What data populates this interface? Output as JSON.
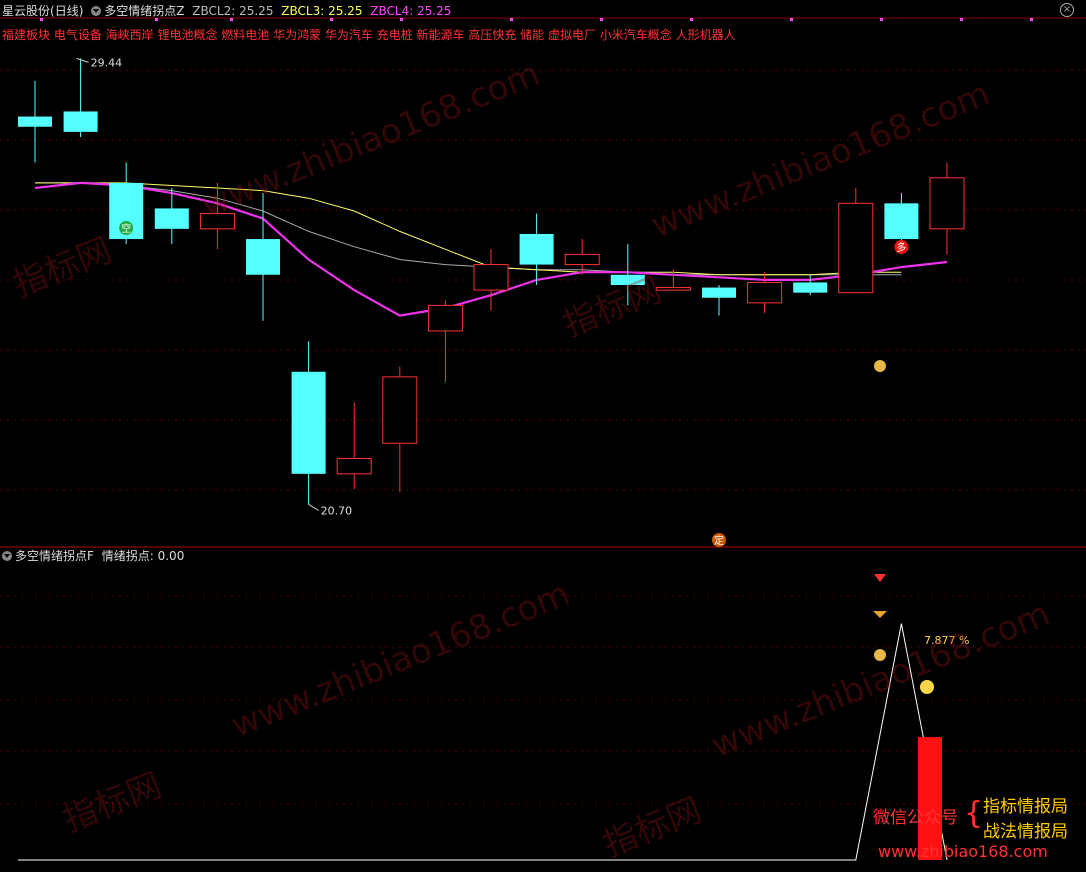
{
  "header": {
    "stock": "星云股份",
    "period": "(日线)",
    "indicator": "多空情绪拐点Z",
    "zb2": {
      "label": "ZBCL2:",
      "value": "25.25",
      "color": "#bbbbbb"
    },
    "zb3": {
      "label": "ZBCL3:",
      "value": "25.25",
      "color": "#ffff55"
    },
    "zb4": {
      "label": "ZBCL4:",
      "value": "25.25",
      "color": "#ff44ff"
    },
    "concepts": "福建板块 电气设备 海峡西岸 锂电池概念 燃料电池 华为鸿蒙 华为汽车 充电桩 新能源车 高压快充 储能 虚拟电厂 小米汽车概念 人形机器人"
  },
  "sub_header": {
    "indicator": "多空情绪拐点F",
    "label": "情绪拐点:",
    "value": "0.00"
  },
  "watermark": {
    "site": "www.zhibiao168.com",
    "cn": "指标网"
  },
  "promo": {
    "left": "微信公众号",
    "right1": "指标情报局",
    "right2": "战法情报局",
    "url": "www.zhibiao168.com"
  },
  "colors": {
    "up": "#ff3333",
    "down": "#55ffff",
    "ma_fast": "#ee33ee",
    "ma_mid": "#ffff66",
    "ma_slow": "#aaaaaa"
  },
  "chart_data": [
    {
      "type": "candlestick",
      "price_high_label": "29.44",
      "price_low_label": "20.70",
      "candles": [
        {
          "o": 28.3,
          "h": 29.0,
          "l": 27.4,
          "c": 28.1
        },
        {
          "o": 28.4,
          "h": 29.44,
          "l": 27.9,
          "c": 28.0
        },
        {
          "o": 27.0,
          "h": 27.4,
          "l": 25.8,
          "c": 25.9
        },
        {
          "o": 26.5,
          "h": 26.9,
          "l": 25.8,
          "c": 26.1
        },
        {
          "o": 26.1,
          "h": 27.0,
          "l": 25.7,
          "c": 26.4
        },
        {
          "o": 25.9,
          "h": 26.8,
          "l": 24.3,
          "c": 25.2
        },
        {
          "o": 23.3,
          "h": 23.9,
          "l": 20.7,
          "c": 21.3
        },
        {
          "o": 21.3,
          "h": 22.7,
          "l": 21.0,
          "c": 21.6
        },
        {
          "o": 21.9,
          "h": 23.4,
          "l": 20.95,
          "c": 23.2
        },
        {
          "o": 24.1,
          "h": 24.7,
          "l": 23.1,
          "c": 24.6
        },
        {
          "o": 24.9,
          "h": 25.7,
          "l": 24.5,
          "c": 25.4
        },
        {
          "o": 26.0,
          "h": 26.4,
          "l": 25.0,
          "c": 25.4
        },
        {
          "o": 25.4,
          "h": 25.9,
          "l": 25.2,
          "c": 25.6
        },
        {
          "o": 25.2,
          "h": 25.8,
          "l": 24.6,
          "c": 25.0
        },
        {
          "o": 24.9,
          "h": 25.3,
          "l": 24.9,
          "c": 24.95
        },
        {
          "o": 24.95,
          "h": 25.0,
          "l": 24.4,
          "c": 24.75
        },
        {
          "o": 24.65,
          "h": 25.25,
          "l": 24.45,
          "c": 25.05
        },
        {
          "o": 25.05,
          "h": 25.2,
          "l": 24.8,
          "c": 24.85
        },
        {
          "o": 24.85,
          "h": 26.9,
          "l": 24.85,
          "c": 26.6
        },
        {
          "o": 26.6,
          "h": 26.8,
          "l": 25.6,
          "c": 25.9
        },
        {
          "o": 26.1,
          "h": 27.4,
          "l": 25.6,
          "c": 27.1
        }
      ],
      "ma_fast": [
        26.9,
        27.0,
        26.95,
        26.8,
        26.6,
        26.3,
        25.5,
        24.9,
        24.4,
        24.55,
        24.8,
        25.1,
        25.25,
        25.25,
        25.2,
        25.15,
        25.1,
        25.1,
        25.2,
        25.35,
        25.45
      ],
      "ma_mid": [
        27.0,
        27.0,
        27.0,
        26.95,
        26.9,
        26.85,
        26.7,
        26.45,
        26.05,
        25.7,
        25.35,
        25.3,
        25.25,
        25.25,
        25.25,
        25.2,
        25.2,
        25.2,
        25.25,
        25.25
      ],
      "ma_slow": [
        27.0,
        27.0,
        26.95,
        26.85,
        26.7,
        26.45,
        26.05,
        25.75,
        25.5,
        25.4,
        25.35,
        25.3,
        25.3,
        25.25,
        25.2,
        25.2,
        25.2,
        25.2,
        25.2,
        25.2
      ],
      "markers": [
        {
          "index": 2,
          "text": "空",
          "bg": "#22aa44"
        },
        {
          "index": 19,
          "text": "多",
          "bg": "#ee1111"
        },
        {
          "index": 15,
          "text": "定",
          "bg": "#cc5500"
        }
      ]
    },
    {
      "type": "line",
      "label_pct": "7.877 %",
      "line": [
        0,
        0,
        0,
        0,
        0,
        0,
        0,
        0,
        0,
        0,
        0,
        0,
        0,
        0,
        0,
        0,
        0,
        0,
        0,
        1.0,
        0
      ],
      "bar_index": 20,
      "bar_value": 0.52,
      "ylim": [
        0,
        1.1
      ]
    }
  ]
}
